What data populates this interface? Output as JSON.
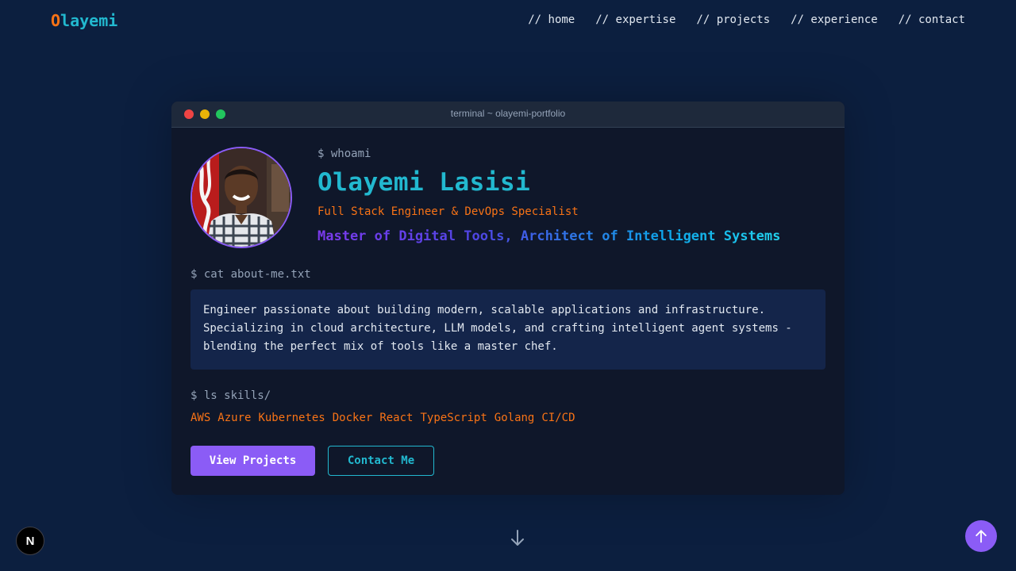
{
  "brand": {
    "first_letter": "O",
    "rest": "layemi"
  },
  "nav": [
    {
      "label": "// home"
    },
    {
      "label": "// expertise"
    },
    {
      "label": "// projects"
    },
    {
      "label": "// experience"
    },
    {
      "label": "// contact"
    }
  ],
  "terminal": {
    "title": "terminal ~ olayemi-portfolio",
    "cmd_whoami": "$ whoami",
    "name": "Olayemi Lasisi",
    "role": "Full Stack Engineer & DevOps Specialist",
    "tagline": "Master of Digital Tools, Architect of Intelligent Systems",
    "cmd_about": "$ cat about-me.txt",
    "about_lines": [
      "Engineer passionate about building modern, scalable applications and infrastructure.",
      "Specializing in cloud architecture, LLM models, and crafting intelligent agent systems -",
      "blending the perfect mix of tools like a master chef."
    ],
    "cmd_skills": "$ ls skills/",
    "skills": [
      "AWS",
      "Azure",
      "Kubernetes",
      "Docker",
      "React",
      "TypeScript",
      "Golang",
      "CI/CD"
    ],
    "buttons": {
      "primary": "View Projects",
      "secondary": "Contact Me"
    }
  },
  "badge": "N",
  "colors": {
    "background": "#0c1f3f",
    "accent_cyan": "#22b8cf",
    "accent_orange": "#f97316",
    "accent_purple": "#8b5cf6"
  },
  "icons": {
    "scroll": "arrow-down-icon",
    "back_to_top": "arrow-up-icon",
    "avatar": "profile-photo"
  }
}
